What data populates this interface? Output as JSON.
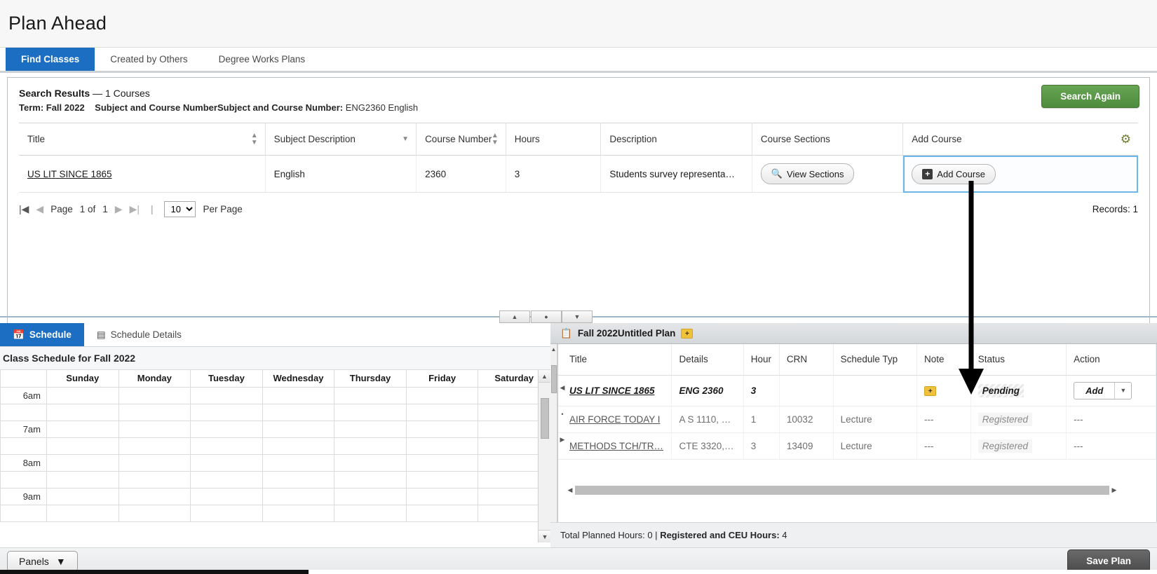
{
  "page": {
    "title": "Plan Ahead"
  },
  "tabs": [
    {
      "label": "Find Classes",
      "active": true
    },
    {
      "label": "Created by Others",
      "active": false
    },
    {
      "label": "Degree Works Plans",
      "active": false
    }
  ],
  "results": {
    "heading_main": "Search Results",
    "heading_count": "— 1 Courses",
    "term_label": "Term: Fall 2022",
    "criteria_label": "Subject and Course NumberSubject and Course Number:",
    "criteria_value": "ENG2360 English",
    "search_again_label": "Search Again",
    "gear_icon": "gear-icon",
    "columns": [
      {
        "label": "Title",
        "sort": "both"
      },
      {
        "label": "Subject Description",
        "sort": "down"
      },
      {
        "label": "Course Number",
        "sort": "both"
      },
      {
        "label": "Hours",
        "sort": "none"
      },
      {
        "label": "Description",
        "sort": "none"
      },
      {
        "label": "Course Sections",
        "sort": "none"
      },
      {
        "label": "Add Course",
        "sort": "none"
      }
    ],
    "rows": [
      {
        "title": "US LIT SINCE 1865",
        "subject": "English",
        "course_number": "2360",
        "hours": "3",
        "description": "Students survey representa…",
        "sections_button": "View Sections",
        "sections_icon": "search-icon",
        "add_button": "Add Course",
        "add_icon": "plus-square-icon"
      }
    ],
    "pager": {
      "first_icon": "first-page-icon",
      "prev_icon": "prev-page-icon",
      "page_label": "Page",
      "page_current": "1 of",
      "page_total": "1",
      "next_icon": "next-page-icon",
      "last_icon": "last-page-icon",
      "per_page_value": "10",
      "per_page_label": "Per Page",
      "records_label": "Records: 1"
    }
  },
  "splitter": {
    "up_icon": "collapse-up-icon",
    "dot_icon": "split-dot-icon",
    "down_icon": "collapse-down-icon"
  },
  "schedule": {
    "tabs": [
      {
        "label": "Schedule",
        "icon": "calendar-icon",
        "active": true
      },
      {
        "label": "Schedule Details",
        "icon": "list-icon",
        "active": false
      }
    ],
    "title": "Class Schedule for Fall 2022",
    "days": [
      "Sunday",
      "Monday",
      "Tuesday",
      "Wednesday",
      "Thursday",
      "Friday",
      "Saturday"
    ],
    "times": [
      "6am",
      "7am",
      "8am",
      "9am"
    ],
    "scroll_up_icon": "scroll-up-icon",
    "scroll_down_icon": "scroll-down-icon"
  },
  "plan": {
    "tab_label": "Fall 2022Untitled Plan",
    "tab_icon": "clipboard-icon",
    "tab_note_icon": "note-add-icon",
    "columns": [
      "Title",
      "Details",
      "Hour",
      "CRN",
      "Schedule Typ",
      "Note",
      "Status",
      "Action"
    ],
    "rows": [
      {
        "title": "US LIT SINCE 1865",
        "details": "ENG 2360",
        "hours": "3",
        "crn": "",
        "schedule_type": "",
        "note": "note-icon",
        "status": "Pending",
        "action_label": "Add",
        "action_caret": "caret-down-icon",
        "pending": true
      },
      {
        "title": "AIR FORCE TODAY I",
        "details": "A S 1110, …",
        "hours": "1",
        "crn": "10032",
        "schedule_type": "Lecture",
        "note": "---",
        "status": "Registered",
        "action_label": "---",
        "pending": false
      },
      {
        "title": "METHODS TCH/TR…",
        "details": "CTE 3320,…",
        "hours": "3",
        "crn": "13409",
        "schedule_type": "Lecture",
        "note": "---",
        "status": "Registered",
        "action_label": "---",
        "pending": false
      }
    ],
    "footer_planned_label": "Total Planned Hours:",
    "footer_planned_value": "0",
    "footer_divider": "|",
    "footer_registered_label": "Registered and CEU Hours:",
    "footer_registered_value": "4"
  },
  "bottom_bar": {
    "panels_label": "Panels",
    "panels_caret": "caret-down-icon",
    "save_plan_label": "Save Plan"
  },
  "colors": {
    "tab_active": "#1b6ec2",
    "search_again": "#4f8c3d",
    "note_yellow": "#f0c23c",
    "save_plan": "#4a4a4a"
  }
}
